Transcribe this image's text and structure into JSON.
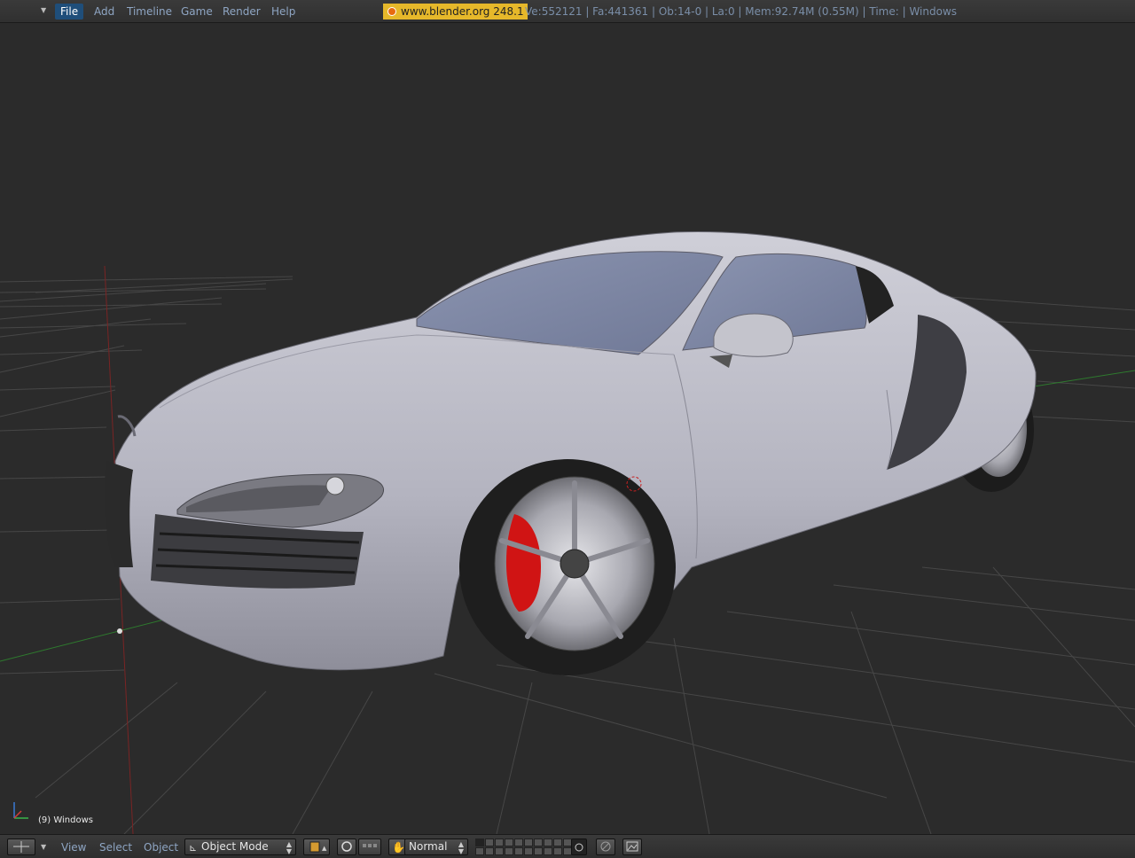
{
  "top_menu": {
    "items": [
      "File",
      "Add",
      "Timeline",
      "Game",
      "Render",
      "Help"
    ],
    "active": "File"
  },
  "brand": {
    "label": "www.blender.org 248.1"
  },
  "stats": {
    "text": "Ve:552121 | Fa:441361 | Ob:14-0 | La:0  | Mem:92.74M (0.55M)  | Time: | Windows"
  },
  "viewport": {
    "object_label": "(9) Windows",
    "colors": {
      "background": "#2b2b2b",
      "grid": "#4a4a4a",
      "x_axis": "#8a2a2a",
      "y_axis": "#2a7a2a",
      "car_body": "#b9b9c6",
      "brake_caliper": "#cc1010"
    }
  },
  "bottom_bar": {
    "menus": [
      "View",
      "Select",
      "Object"
    ],
    "mode": "Object Mode",
    "shading_mode": "Normal",
    "icons": [
      "view-type-icon",
      "draw-type-icon",
      "pivot-icon",
      "manipulator-icon",
      "grab-icon",
      "lock-icon",
      "render-icon"
    ]
  }
}
